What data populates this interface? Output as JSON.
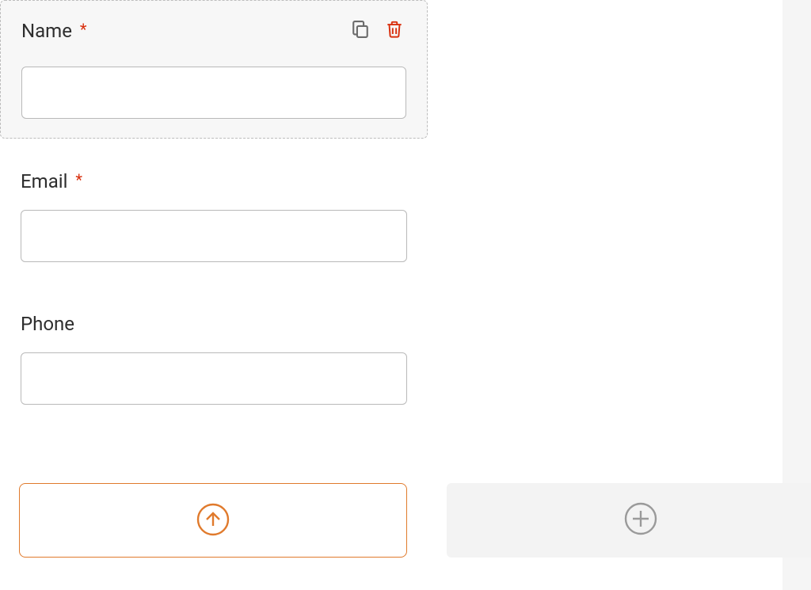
{
  "fields": [
    {
      "label": "Name",
      "required": true,
      "selected": true,
      "value": ""
    },
    {
      "label": "Email",
      "required": true,
      "selected": false,
      "value": ""
    },
    {
      "label": "Phone",
      "required": false,
      "selected": false,
      "value": ""
    }
  ],
  "actions": {
    "duplicate_icon": "copy-icon",
    "delete_icon": "trash-icon",
    "submit_icon": "arrow-up-circle-icon",
    "add_icon": "plus-circle-icon"
  },
  "colors": {
    "accent": "#e07a2c",
    "danger": "#d9300f",
    "muted_icon": "#6b6b6b",
    "plus_icon": "#9a9a9a"
  }
}
